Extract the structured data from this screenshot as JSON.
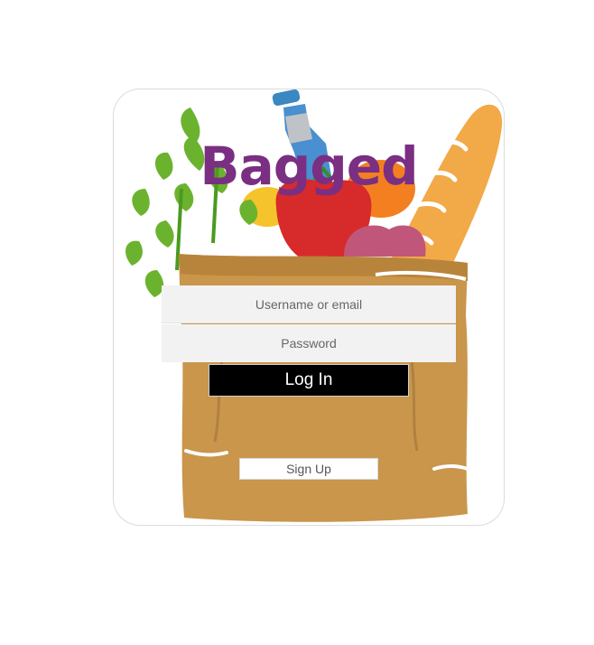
{
  "app": {
    "brand_title": "Bagged"
  },
  "login_form": {
    "username_placeholder": "Username or email",
    "password_placeholder": "Password",
    "login_label": "Log In",
    "signup_label": "Sign Up"
  },
  "colors": {
    "brand": "#7a2f82",
    "bag": "#c9964b",
    "login_button_bg": "#000000",
    "field_bg": "#f2f2f2"
  },
  "icons": {
    "background_art": "grocery-bag-illustration"
  }
}
